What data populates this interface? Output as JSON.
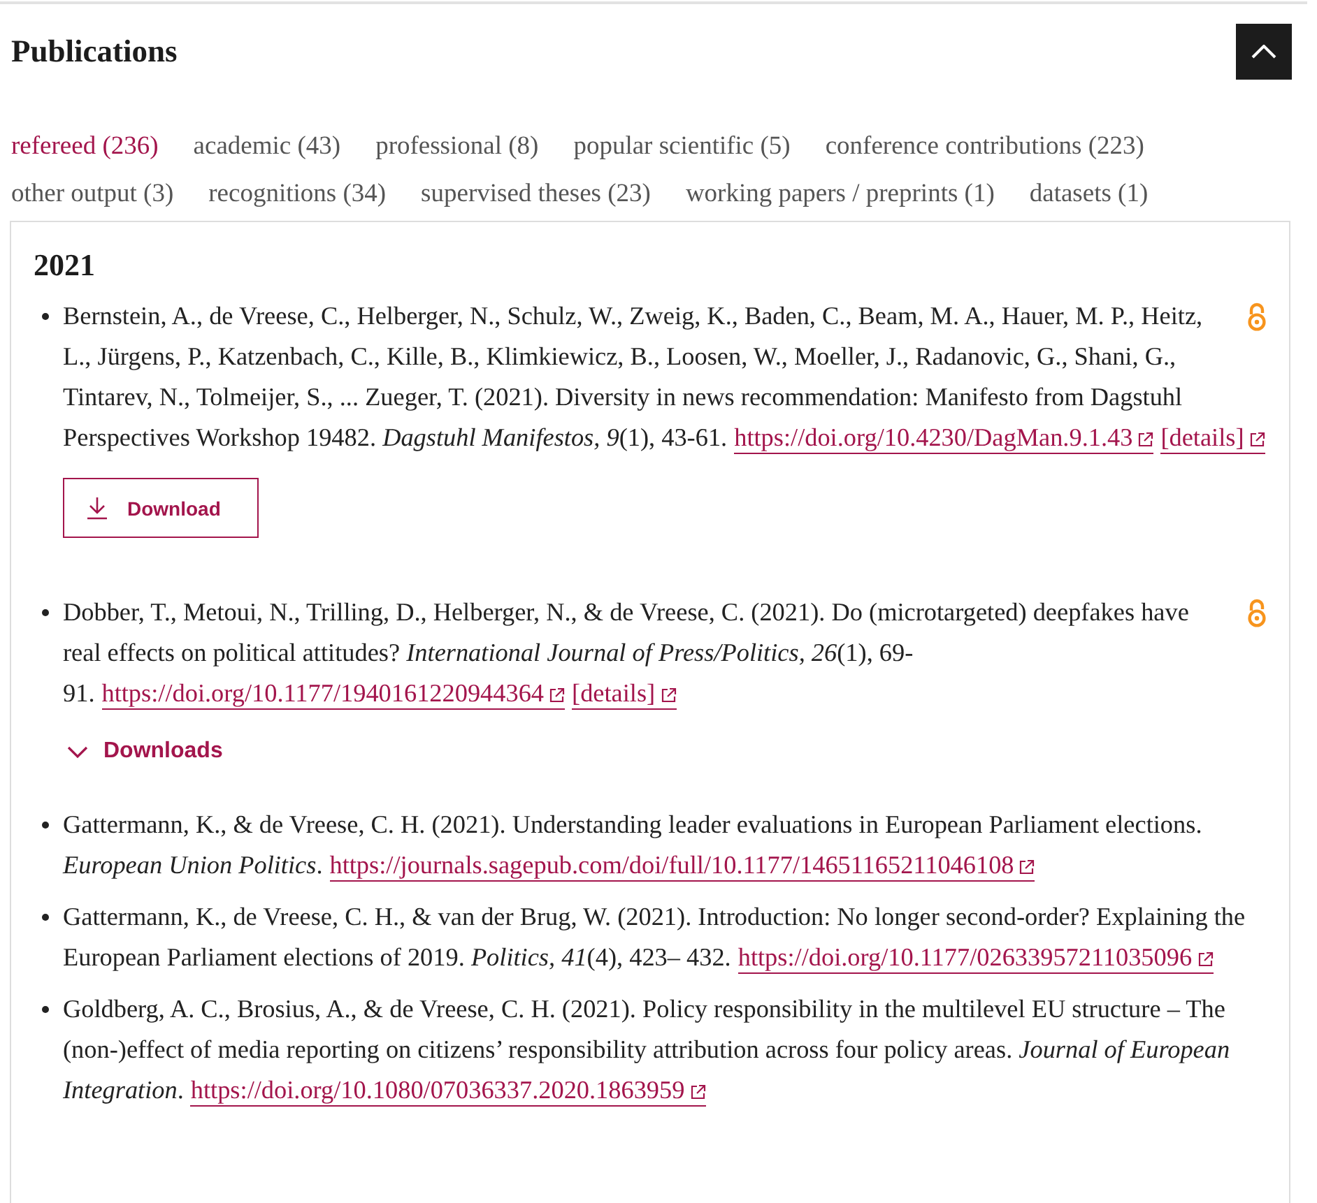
{
  "section": {
    "title": "Publications",
    "expanded": true
  },
  "tabs": [
    {
      "label": "refereed (236)",
      "selected": true
    },
    {
      "label": "academic (43)",
      "selected": false
    },
    {
      "label": "professional (8)",
      "selected": false
    },
    {
      "label": "popular scientific (5)",
      "selected": false
    },
    {
      "label": "conference contributions (223)",
      "selected": false
    },
    {
      "label": "other output (3)",
      "selected": false
    },
    {
      "label": "recognitions (34)",
      "selected": false
    },
    {
      "label": "supervised theses (23)",
      "selected": false
    },
    {
      "label": "working papers / preprints (1)",
      "selected": false
    },
    {
      "label": "datasets (1)",
      "selected": false
    }
  ],
  "panel": {
    "year": "2021",
    "publications": [
      {
        "citation": "Bernstein, A., de Vreese, C., Helberger, N., Schulz, W., Zweig, K., Baden, C., Beam, M. A., Hauer, M. P., Heitz, L., Jürgens, P., Katzenbach, C., Kille, B., Klimkiewicz, B., Loosen, W., Moeller, J., Radanovic, G., Shani, G., Tintarev, N., Tolmeijer, S., ... Zueger, T. (2021). Diversity in news recommendation: Manifesto from Dagstuhl Perspectives Workshop 19482. *Dagstuhl Manifestos, 9*(1), 43-61.",
        "open_access": true,
        "links": [
          "https://doi.org/10.4230/DagMan.9.1.43",
          "[details]"
        ],
        "action": {
          "kind": "download_button",
          "label": "Download"
        }
      },
      {
        "citation": "Dobber, T., Metoui, N., Trilling, D., Helberger, N., & de Vreese, C. (2021). Do (microtargeted) deepfakes have real effects on political attitudes? *International Journal of Press/Politics, 26*(1), 69-91.",
        "open_access": true,
        "links": [
          "https://doi.org/10.1177/1940161220944364",
          "[details]"
        ],
        "action": {
          "kind": "downloads_toggle",
          "label": "Downloads",
          "expanded": false
        }
      },
      {
        "citation": "Gattermann, K., & de Vreese, C. H. (2021). Understanding leader evaluations in European Parliament elections. *European Union Politics*.",
        "open_access": false,
        "links": [
          "https://journals.sagepub.com/doi/full/10.1177/14651165211046108"
        ]
      },
      {
        "citation": "Gattermann, K., de Vreese, C. H., & van der Brug, W. (2021). Introduction: No longer second-order? Explaining the European Parliament elections of 2019. *Politics, 41*(4), 423– 432.",
        "open_access": false,
        "links": [
          "https://doi.org/10.1177/02633957211035096"
        ]
      },
      {
        "citation": "Goldberg, A. C., Brosius, A., & de Vreese, C. H. (2021). Policy responsibility in the multilevel EU structure – The (non-)effect of media reporting on citizens’ responsibility attribution across four policy areas. *Journal of European Integration*.",
        "open_access": false,
        "links": [
          "https://doi.org/10.1080/07036337.2020.1863959"
        ]
      }
    ]
  }
}
